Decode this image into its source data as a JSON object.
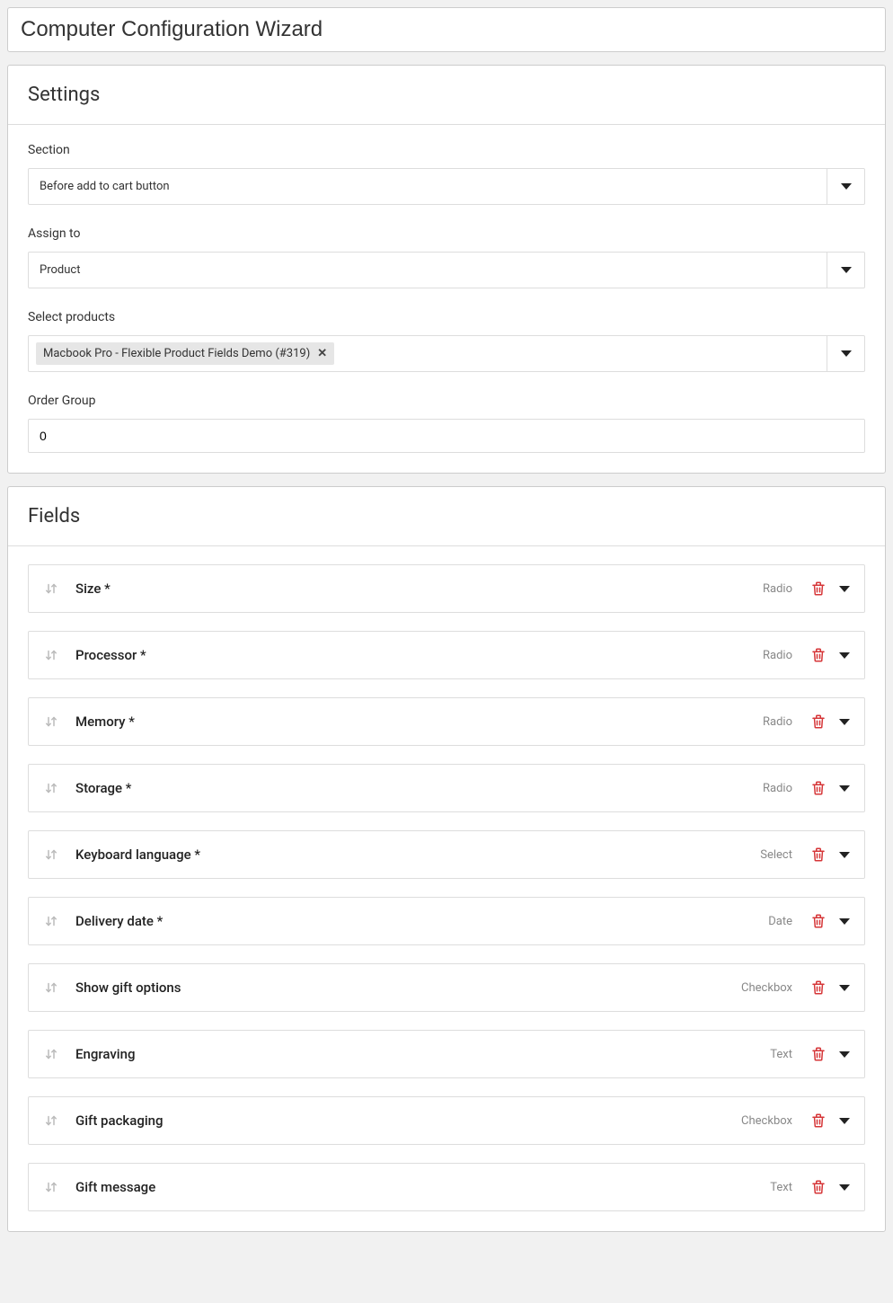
{
  "page_title": "Computer Configuration Wizard",
  "settings_panel": {
    "heading": "Settings",
    "section": {
      "label": "Section",
      "value": "Before add to cart button"
    },
    "assign_to": {
      "label": "Assign to",
      "value": "Product"
    },
    "select_products": {
      "label": "Select products",
      "tag": "Macbook Pro - Flexible Product Fields Demo (#319)"
    },
    "order_group": {
      "label": "Order Group",
      "value": "0"
    }
  },
  "fields_panel": {
    "heading": "Fields",
    "items": [
      {
        "name": "Size *",
        "type": "Radio"
      },
      {
        "name": "Processor *",
        "type": "Radio"
      },
      {
        "name": "Memory *",
        "type": "Radio"
      },
      {
        "name": "Storage *",
        "type": "Radio"
      },
      {
        "name": "Keyboard language *",
        "type": "Select"
      },
      {
        "name": "Delivery date *",
        "type": "Date"
      },
      {
        "name": "Show gift options",
        "type": "Checkbox"
      },
      {
        "name": "Engraving",
        "type": "Text"
      },
      {
        "name": "Gift packaging",
        "type": "Checkbox"
      },
      {
        "name": "Gift message",
        "type": "Text"
      }
    ]
  }
}
